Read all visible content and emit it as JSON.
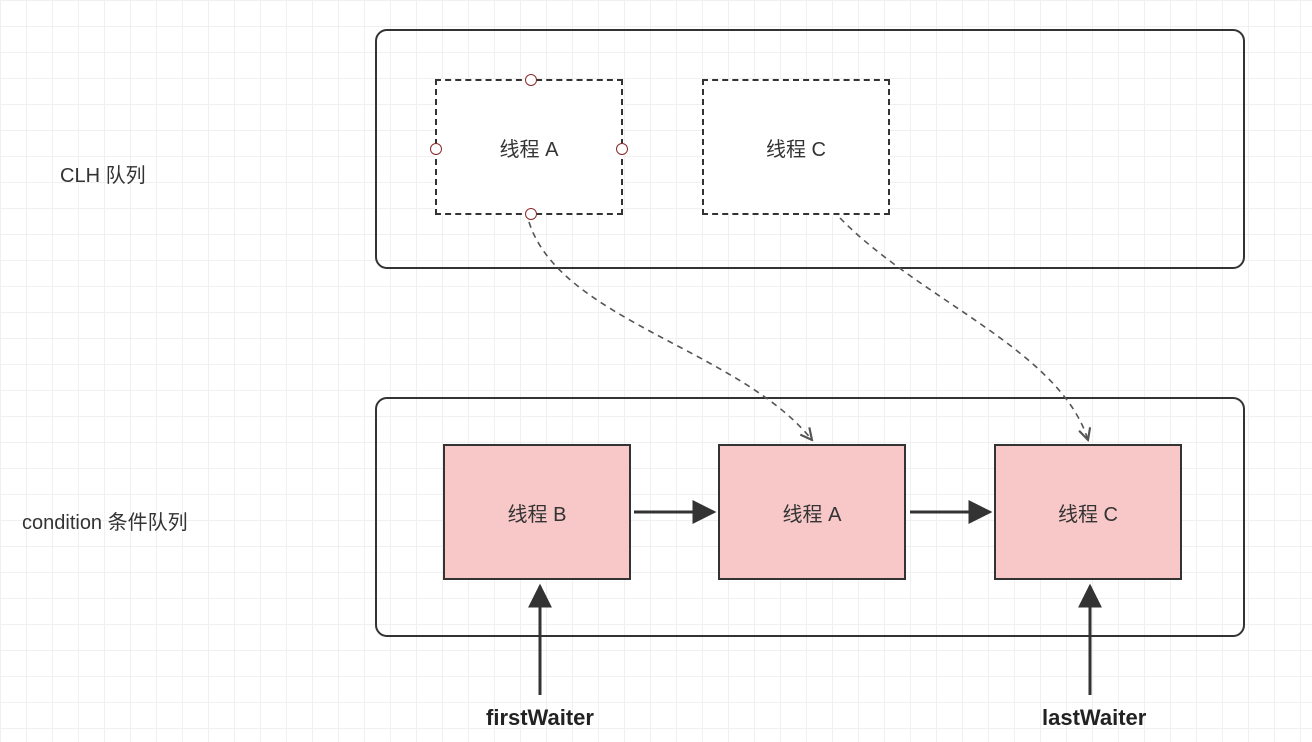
{
  "labels": {
    "clh_queue": "CLH 队列",
    "condition_queue": "condition 条件队列",
    "first_waiter": "firstWaiter",
    "last_waiter": "lastWaiter"
  },
  "clh": {
    "node_a": "线程 A",
    "node_c": "线程 C"
  },
  "condition": {
    "node_b": "线程 B",
    "node_a": "线程 A",
    "node_c": "线程 C"
  },
  "colors": {
    "pink_fill": "#f8c8c8",
    "border": "#333333",
    "port_border": "#8b2b2b"
  }
}
